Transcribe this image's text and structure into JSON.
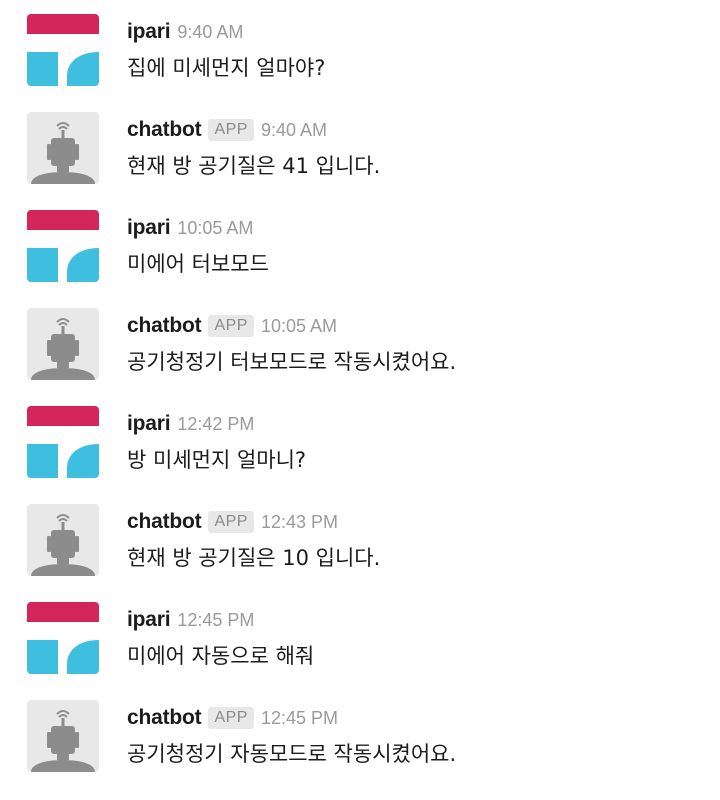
{
  "messages": [
    {
      "sender": "ipari",
      "avatar": "ipari-logo-icon",
      "is_app": false,
      "badge": "",
      "time": "9:40 AM",
      "text": "집에 미세먼지 얼마야?"
    },
    {
      "sender": "chatbot",
      "avatar": "robot-icon",
      "is_app": true,
      "badge": "APP",
      "time": "9:40 AM",
      "text": "현재 방 공기질은 41 입니다."
    },
    {
      "sender": "ipari",
      "avatar": "ipari-logo-icon",
      "is_app": false,
      "badge": "",
      "time": "10:05 AM",
      "text": "미에어 터보모드"
    },
    {
      "sender": "chatbot",
      "avatar": "robot-icon",
      "is_app": true,
      "badge": "APP",
      "time": "10:05 AM",
      "text": "공기청정기 터보모드로 작동시켰어요."
    },
    {
      "sender": "ipari",
      "avatar": "ipari-logo-icon",
      "is_app": false,
      "badge": "",
      "time": "12:42 PM",
      "text": "방 미세먼지 얼마니?"
    },
    {
      "sender": "chatbot",
      "avatar": "robot-icon",
      "is_app": true,
      "badge": "APP",
      "time": "12:43 PM",
      "text": "현재 방 공기질은 10 입니다."
    },
    {
      "sender": "ipari",
      "avatar": "ipari-logo-icon",
      "is_app": false,
      "badge": "",
      "time": "12:45 PM",
      "text": "미에어 자동으로 해줘"
    },
    {
      "sender": "chatbot",
      "avatar": "robot-icon",
      "is_app": true,
      "badge": "APP",
      "time": "12:45 PM",
      "text": "공기청정기 자동모드로 작동시켰어요."
    }
  ],
  "colors": {
    "ipari_red": "#d4265a",
    "ipari_blue": "#3fbfdf",
    "robot_bg": "#e8e8e8",
    "robot_gray": "#8c8c8c"
  }
}
